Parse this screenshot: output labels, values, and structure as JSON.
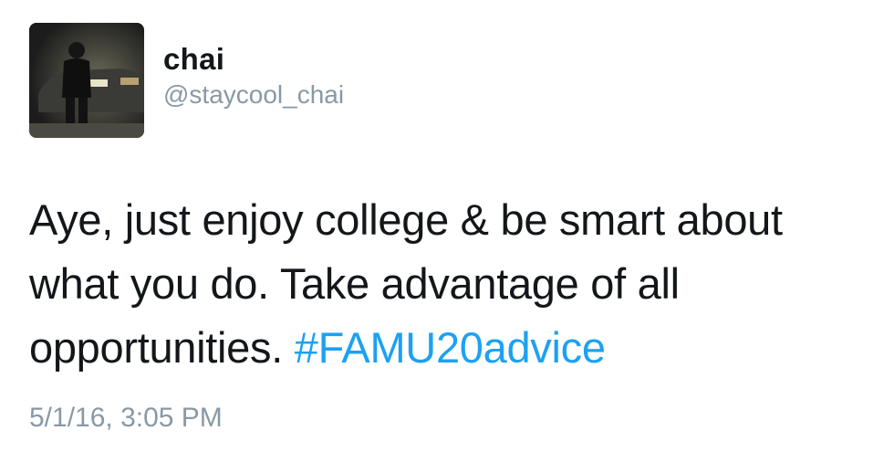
{
  "tweet": {
    "display_name": "chai",
    "handle": "@staycool_chai",
    "text_before_hashtag": "Aye, just enjoy college & be smart about what you do. Take advantage of all opportunities. ",
    "hashtag": "#FAMU20advice",
    "timestamp": "5/1/16, 3:05 PM"
  },
  "colors": {
    "text": "#14171a",
    "secondary_text": "#8899a6",
    "hashtag": "#1da1f2",
    "background": "#ffffff"
  }
}
